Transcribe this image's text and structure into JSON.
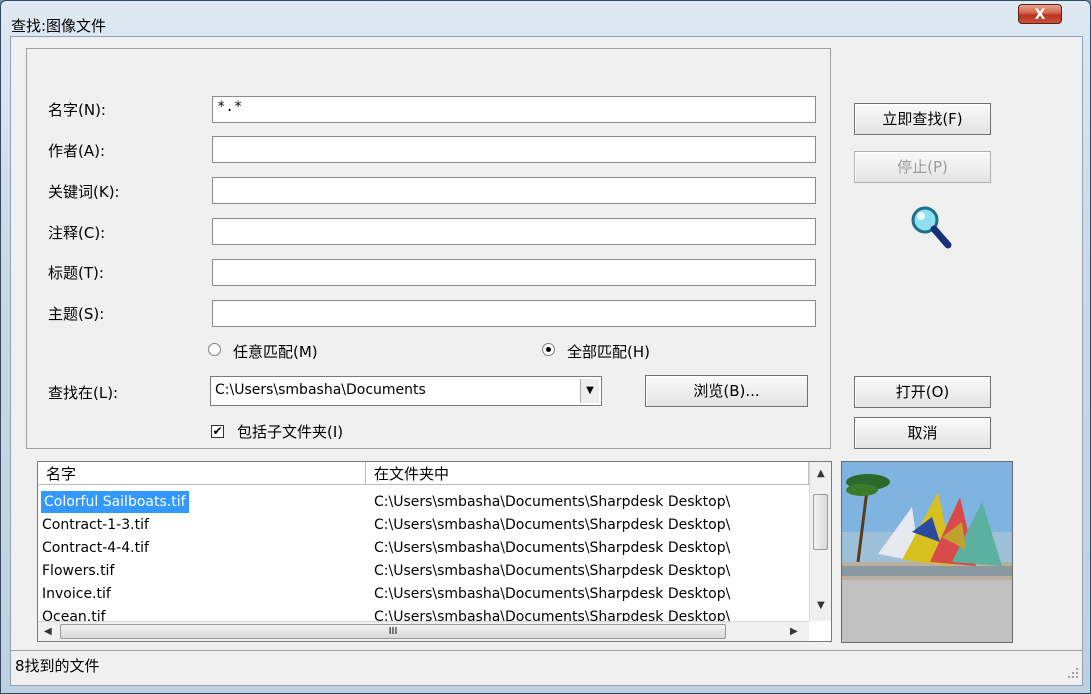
{
  "window": {
    "title": "查找:图像文件",
    "close_glyph": "X"
  },
  "form": {
    "fields": [
      {
        "label": "名字(N):",
        "value": "*.*"
      },
      {
        "label": "作者(A):",
        "value": ""
      },
      {
        "label": "关键词(K):",
        "value": ""
      },
      {
        "label": "注释(C):",
        "value": ""
      },
      {
        "label": "标题(T):",
        "value": ""
      },
      {
        "label": "主题(S):",
        "value": ""
      }
    ],
    "match_any": {
      "label": "任意匹配(M)",
      "selected": false
    },
    "match_all": {
      "label": "全部匹配(H)",
      "selected": true
    },
    "search_in": {
      "label": "查找在(L):",
      "value": "C:\\Users\\smbasha\\Documents"
    },
    "browse_label": "浏览(B)...",
    "include_subfolders": {
      "label": "包括子文件夹(I)",
      "checked": true,
      "check_glyph": "✔"
    }
  },
  "buttons": {
    "find_now": "立即查找(F)",
    "stop": "停止(P)",
    "open": "打开(O)",
    "cancel": "取消"
  },
  "results": {
    "columns": [
      "名字",
      "在文件夹中"
    ],
    "rows": [
      {
        "name": "Colorful Sailboats.tif",
        "folder": "C:\\Users\\smbasha\\Documents\\Sharpdesk Desktop\\",
        "selected": true
      },
      {
        "name": "Contract-1-3.tif",
        "folder": "C:\\Users\\smbasha\\Documents\\Sharpdesk Desktop\\"
      },
      {
        "name": "Contract-4-4.tif",
        "folder": "C:\\Users\\smbasha\\Documents\\Sharpdesk Desktop\\"
      },
      {
        "name": "Flowers.tif",
        "folder": "C:\\Users\\smbasha\\Documents\\Sharpdesk Desktop\\"
      },
      {
        "name": "Invoice.tif",
        "folder": "C:\\Users\\smbasha\\Documents\\Sharpdesk Desktop\\"
      },
      {
        "name": "Ocean.tif",
        "folder": "C:\\Users\\smbasha\\Documents\\Sharpdesk Desktop\\"
      }
    ],
    "hscroll_grip": "III"
  },
  "status": {
    "text": "8找到的文件"
  },
  "icons": {
    "search": "magnifier-icon",
    "preview": "sailboats-thumbnail"
  }
}
